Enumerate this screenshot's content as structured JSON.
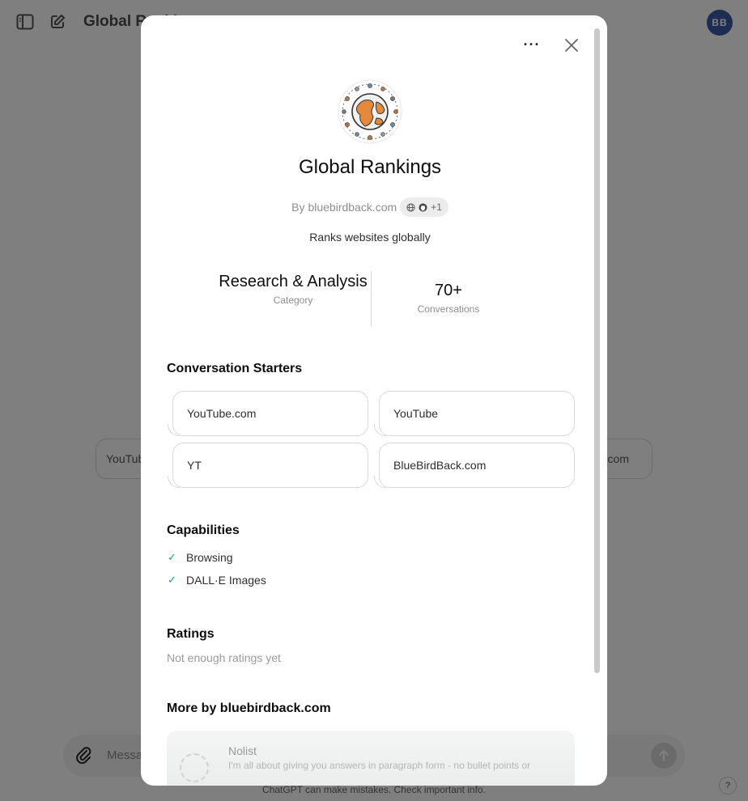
{
  "app": {
    "title": "Global Rankings",
    "avatar_initials": "BB",
    "composer_placeholder": "Message Global Rankings...",
    "disclaimer": "ChatGPT can make mistakes. Check important info.",
    "help": "?",
    "bg_starters": [
      "YouTube.com",
      "BlueBirdBack.com"
    ]
  },
  "modal": {
    "more_label": "···",
    "name": "Global Rankings",
    "by_prefix": "By",
    "author": "bluebirdback.com",
    "social_extra": "+1",
    "description": "Ranks websites globally",
    "stats": {
      "category_value": "Research & Analysis",
      "category_label": "Category",
      "conversations_value": "70+",
      "conversations_label": "Conversations"
    },
    "starters_heading": "Conversation Starters",
    "starters": [
      "YouTube.com",
      "YouTube",
      "YT",
      "BlueBirdBack.com"
    ],
    "capabilities_heading": "Capabilities",
    "capabilities": [
      "Browsing",
      "DALL·E Images"
    ],
    "ratings_heading": "Ratings",
    "ratings_empty": "Not enough ratings yet",
    "more_by_heading": "More by bluebirdback.com",
    "more_by": [
      {
        "title": "Nolist",
        "description": "I'm all about giving you answers in paragraph form - no bullet points or"
      }
    ]
  },
  "colors": {
    "overlay": "rgba(0,0,0,0.5)",
    "check": "#10a37f",
    "avatar": "#3b5ba5"
  }
}
